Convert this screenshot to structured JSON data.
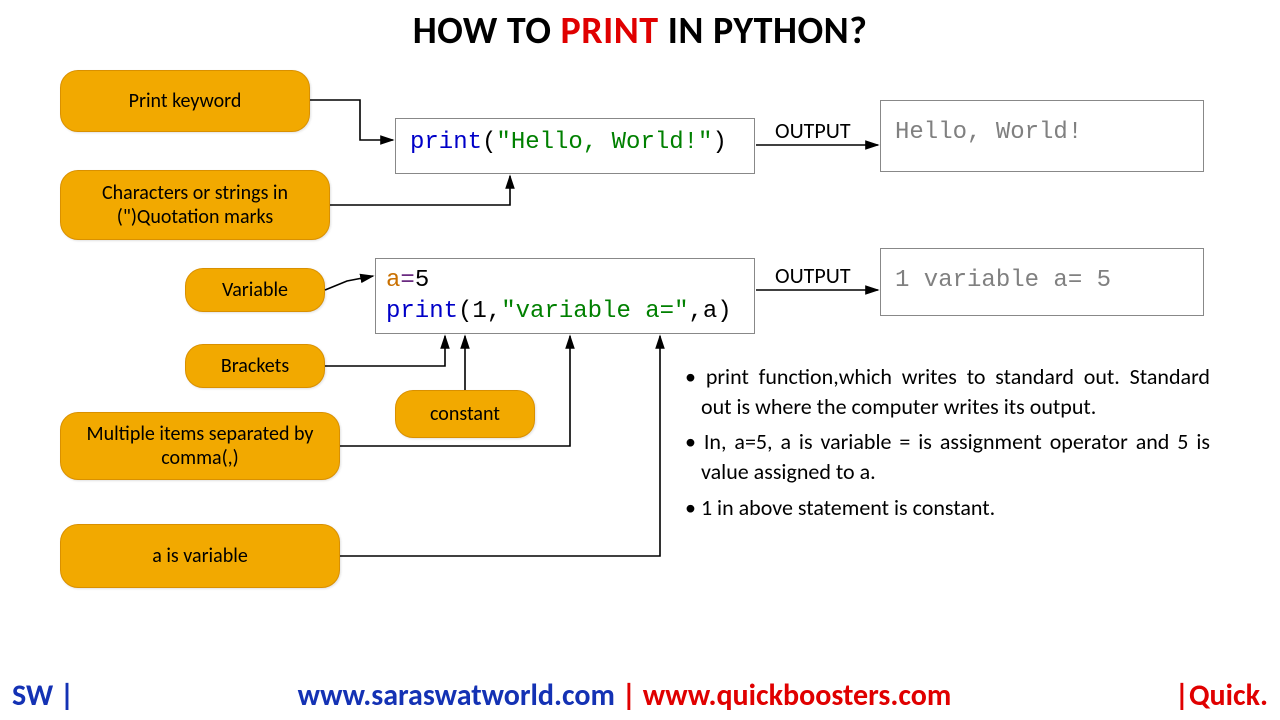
{
  "title": {
    "pre": "HOW TO ",
    "accent": "PRINT",
    "post": " IN PYTHON?"
  },
  "labels": {
    "print_keyword": "Print keyword",
    "chars_strings": "Characters or strings in (\")Quotation marks",
    "variable": "Variable",
    "brackets": "Brackets",
    "constant": "constant",
    "multi_items": "Multiple items separated by  comma(,)",
    "a_is_var": "a is variable"
  },
  "code1": {
    "fn": "print",
    "open": "(",
    "str": "\"Hello, World!\"",
    "close": ")"
  },
  "code2": {
    "var": "a",
    "eq": "=",
    "val": "5",
    "fn": "print",
    "open": "(",
    "one": "1",
    "c1": ",",
    "str": "\"variable a=\"",
    "c2": ",",
    "arg": "a",
    "close": ")"
  },
  "output_label": "OUTPUT",
  "output1": "Hello, World!",
  "output2": "1 variable a= 5",
  "notes": {
    "n1": "print function,which writes to standard out. Standard out is where the computer writes its output.",
    "n2": "In, a=5, a is variable = is assignment operator and 5 is value assigned to a.",
    "n3": "1 in above statement is constant."
  },
  "footer": {
    "left": "SW |",
    "mid_blue": "www.saraswatworld.com",
    "mid_sep": " | ",
    "mid_red": "www.quickboosters.com",
    "right": "|Quick."
  }
}
